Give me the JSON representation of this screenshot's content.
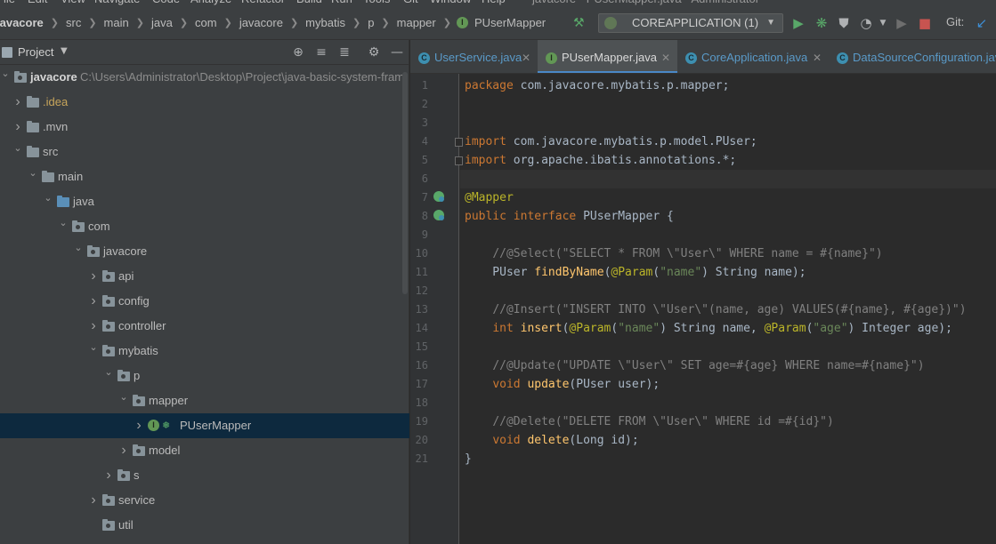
{
  "menubar": {
    "items": [
      "File",
      "Edit",
      "View",
      "Navigate",
      "Code",
      "Analyze",
      "Refactor",
      "Build",
      "Run",
      "Tools",
      "Git",
      "Window",
      "Help"
    ],
    "window_title": "javacore - PUserMapper.java - Administrator"
  },
  "breadcrumbs": [
    "javacore",
    "src",
    "main",
    "java",
    "com",
    "javacore",
    "mybatis",
    "p",
    "mapper",
    "PUserMapper"
  ],
  "toolbar": {
    "run_config": "COREAPPLICATION (1)",
    "git_label": "Git:"
  },
  "project_panel": {
    "title": "Project",
    "tree": [
      {
        "label": "javacore",
        "path": "C:\\Users\\Administrator\\Desktop\\Project\\java-basic-system-fram",
        "depth": 0,
        "expanded": true,
        "kind": "module"
      },
      {
        "label": ".idea",
        "depth": 1,
        "expanded": false,
        "kind": "folder"
      },
      {
        "label": ".mvn",
        "depth": 1,
        "expanded": false,
        "kind": "folder"
      },
      {
        "label": "src",
        "depth": 1,
        "expanded": true,
        "kind": "folder"
      },
      {
        "label": "main",
        "depth": 2,
        "expanded": true,
        "kind": "folder"
      },
      {
        "label": "java",
        "depth": 3,
        "expanded": true,
        "kind": "source"
      },
      {
        "label": "com",
        "depth": 4,
        "expanded": true,
        "kind": "package"
      },
      {
        "label": "javacore",
        "depth": 5,
        "expanded": true,
        "kind": "package"
      },
      {
        "label": "api",
        "depth": 6,
        "expanded": false,
        "kind": "package"
      },
      {
        "label": "config",
        "depth": 6,
        "expanded": false,
        "kind": "package"
      },
      {
        "label": "controller",
        "depth": 6,
        "expanded": false,
        "kind": "package"
      },
      {
        "label": "mybatis",
        "depth": 6,
        "expanded": true,
        "kind": "package"
      },
      {
        "label": "p",
        "depth": 7,
        "expanded": true,
        "kind": "package"
      },
      {
        "label": "mapper",
        "depth": 8,
        "expanded": true,
        "kind": "package"
      },
      {
        "label": "PUserMapper",
        "depth": 9,
        "expanded": false,
        "kind": "interface",
        "selected": true
      },
      {
        "label": "model",
        "depth": 8,
        "expanded": false,
        "kind": "package"
      },
      {
        "label": "s",
        "depth": 7,
        "expanded": false,
        "kind": "package"
      },
      {
        "label": "service",
        "depth": 6,
        "expanded": false,
        "kind": "package"
      },
      {
        "label": "util",
        "depth": 6,
        "expanded": null,
        "kind": "package"
      }
    ]
  },
  "editor_tabs": [
    {
      "label": "UserService.java",
      "icon": "class-icon",
      "active": false
    },
    {
      "label": "PUserMapper.java",
      "icon": "interface-icon",
      "active": true
    },
    {
      "label": "CoreApplication.java",
      "icon": "spring-class-icon",
      "active": false
    },
    {
      "label": "DataSourceConfiguration.java",
      "icon": "class-icon",
      "active": false
    }
  ],
  "code_lines": [
    "package com.javacore.mybatis.p.mapper;",
    "",
    "",
    "import com.javacore.mybatis.p.model.PUser;",
    "import org.apache.ibatis.annotations.*;",
    "",
    "@Mapper",
    "public interface PUserMapper {",
    "",
    "    //@Select(\"SELECT * FROM \\\"User\\\" WHERE name = #{name}\")",
    "    PUser findByName(@Param(\"name\") String name);",
    "",
    "    //@Insert(\"INSERT INTO \\\"User\\\"(name, age) VALUES(#{name}, #{age})\")",
    "    int insert(@Param(\"name\") String name, @Param(\"age\") Integer age);",
    "",
    "    //@Update(\"UPDATE \\\"User\\\" SET age=#{age} WHERE name=#{name}\")",
    "    void update(PUser user);",
    "",
    "    //@Delete(\"DELETE FROM \\\"User\\\" WHERE id =#{id}\")",
    "    void delete(Long id);",
    "}"
  ],
  "colors": {
    "keyword": "#cc7832",
    "annotation": "#bbb529",
    "string": "#6a8759",
    "comment": "#808080",
    "method": "#ffc66d",
    "text": "#a9b7c6",
    "selection": "#0d293e",
    "accent": "#4a88c7"
  }
}
